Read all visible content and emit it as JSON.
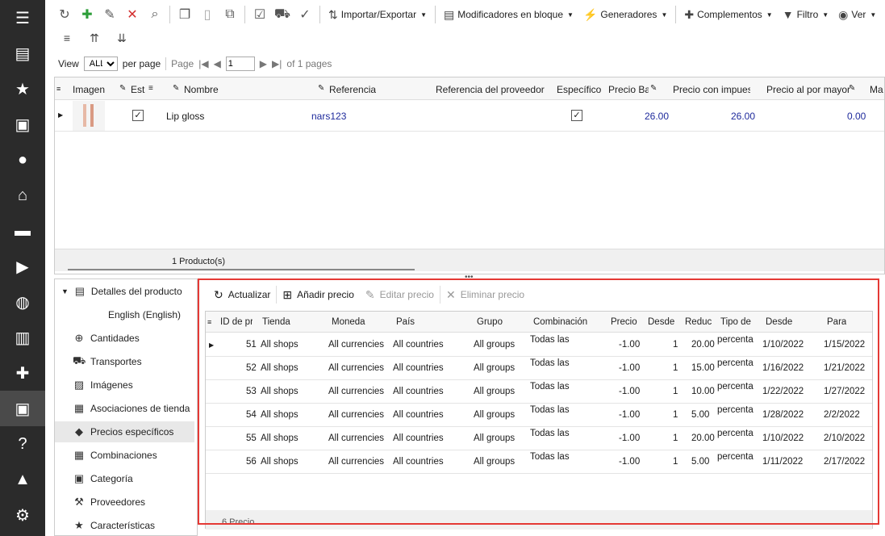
{
  "toolbar": {
    "import_export": "Importar/Exportar",
    "bulk_modifiers": "Modificadores en bloque",
    "generators": "Generadores",
    "addons": "Complementos",
    "filter": "Filtro",
    "view": "Ver"
  },
  "pager": {
    "view_label": "View",
    "per_page_value": "ALL",
    "per_page_label": "per page",
    "page_label": "Page",
    "page_value": "1",
    "of_pages": "of 1 pages"
  },
  "products_grid": {
    "headers": [
      "Imagen",
      "Esta",
      "Nombre",
      "Referencia",
      "Referencia del proveedor",
      "Específico",
      "Precio Bas",
      "Precio con impues",
      "Precio al por mayor",
      "Ma"
    ],
    "row": {
      "name": "Lip gloss",
      "reference": "nars123",
      "base_price": "26.00",
      "price_tax": "26.00",
      "wholesale": "0.00"
    },
    "footer": "1 Producto(s)"
  },
  "tree": {
    "root": "Detalles del producto",
    "items": [
      "English (English)",
      "Cantidades",
      "Transportes",
      "Imágenes",
      "Asociaciones de tienda",
      "Precios específicos",
      "Combinaciones",
      "Categoría",
      "Proveedores",
      "Características"
    ]
  },
  "detail_toolbar": {
    "refresh": "Actualizar",
    "add": "Añadir precio",
    "edit": "Editar precio",
    "delete": "Eliminar precio"
  },
  "prices_grid": {
    "headers": [
      "ID de pr",
      "Tienda",
      "Moneda",
      "País",
      "Grupo",
      "Combinación",
      "Precio",
      "Desde",
      "Reduc",
      "Tipo de",
      "Desde",
      "Para"
    ],
    "rows": [
      {
        "id": "51",
        "shop": "All shops",
        "currency": "All currencies",
        "country": "All countries",
        "group": "All groups",
        "comb": "Todas las",
        "price": "-1.00",
        "from_qty": "1",
        "reduction": "20.00",
        "type": "percenta",
        "from": "1/10/2022",
        "to": "1/15/2022"
      },
      {
        "id": "52",
        "shop": "All shops",
        "currency": "All currencies",
        "country": "All countries",
        "group": "All groups",
        "comb": "Todas las",
        "price": "-1.00",
        "from_qty": "1",
        "reduction": "15.00",
        "type": "percenta",
        "from": "1/16/2022",
        "to": "1/21/2022"
      },
      {
        "id": "53",
        "shop": "All shops",
        "currency": "All currencies",
        "country": "All countries",
        "group": "All groups",
        "comb": "Todas las",
        "price": "-1.00",
        "from_qty": "1",
        "reduction": "10.00",
        "type": "percenta",
        "from": "1/22/2022",
        "to": "1/27/2022"
      },
      {
        "id": "54",
        "shop": "All shops",
        "currency": "All currencies",
        "country": "All countries",
        "group": "All groups",
        "comb": "Todas las",
        "price": "-1.00",
        "from_qty": "1",
        "reduction": "5.00",
        "type": "percenta",
        "from": "1/28/2022",
        "to": "2/2/2022"
      },
      {
        "id": "55",
        "shop": "All shops",
        "currency": "All currencies",
        "country": "All countries",
        "group": "All groups",
        "comb": "Todas las",
        "price": "-1.00",
        "from_qty": "1",
        "reduction": "20.00",
        "type": "percenta",
        "from": "1/10/2022",
        "to": "2/10/2022"
      },
      {
        "id": "56",
        "shop": "All shops",
        "currency": "All currencies",
        "country": "All countries",
        "group": "All groups",
        "comb": "Todas las",
        "price": "-1.00",
        "from_qty": "1",
        "reduction": "5.00",
        "type": "percenta",
        "from": "1/11/2022",
        "to": "2/17/2022"
      }
    ],
    "footer": "6 Precio"
  },
  "colors": {
    "sidebar": "#2b2b2b",
    "highlight": "#e53935",
    "number": "#1e2a9c"
  }
}
